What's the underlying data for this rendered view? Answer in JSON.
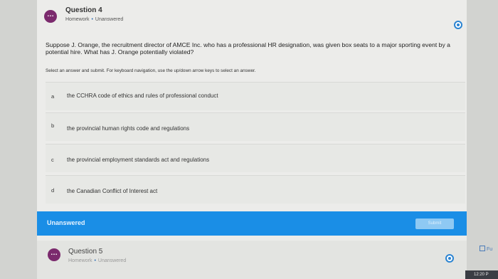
{
  "question4": {
    "title": "Question 4",
    "type": "Homework",
    "status": "Unanswered",
    "prompt": "Suppose J. Orange, the recruitment director of AMCE Inc. who has a professional HR designation, was given box seats to a major sporting event by a potential hire. What has J. Orange potentially violated?",
    "instructions": "Select an answer and submit. For keyboard navigation, use the up/down arrow keys to select an answer.",
    "options": [
      {
        "letter": "a",
        "text": "the CCHRA code of ethics and rules of professional conduct"
      },
      {
        "letter": "b",
        "text": "the provincial human rights code and regulations"
      },
      {
        "letter": "c",
        "text": "the provincial employment standards act and regulations"
      },
      {
        "letter": "d",
        "text": "the Canadian Conflict of Interest act"
      }
    ],
    "answer_status": "Unanswered",
    "submit_label": "Submit"
  },
  "question5": {
    "title": "Question 5",
    "type": "Homework",
    "status": "Unanswered"
  },
  "side": {
    "fu_label": "Fu"
  },
  "taskbar": {
    "clock": "12:20 P"
  },
  "colors": {
    "accent_blue": "#1a8ee6",
    "question_icon": "#7b2a6d"
  }
}
